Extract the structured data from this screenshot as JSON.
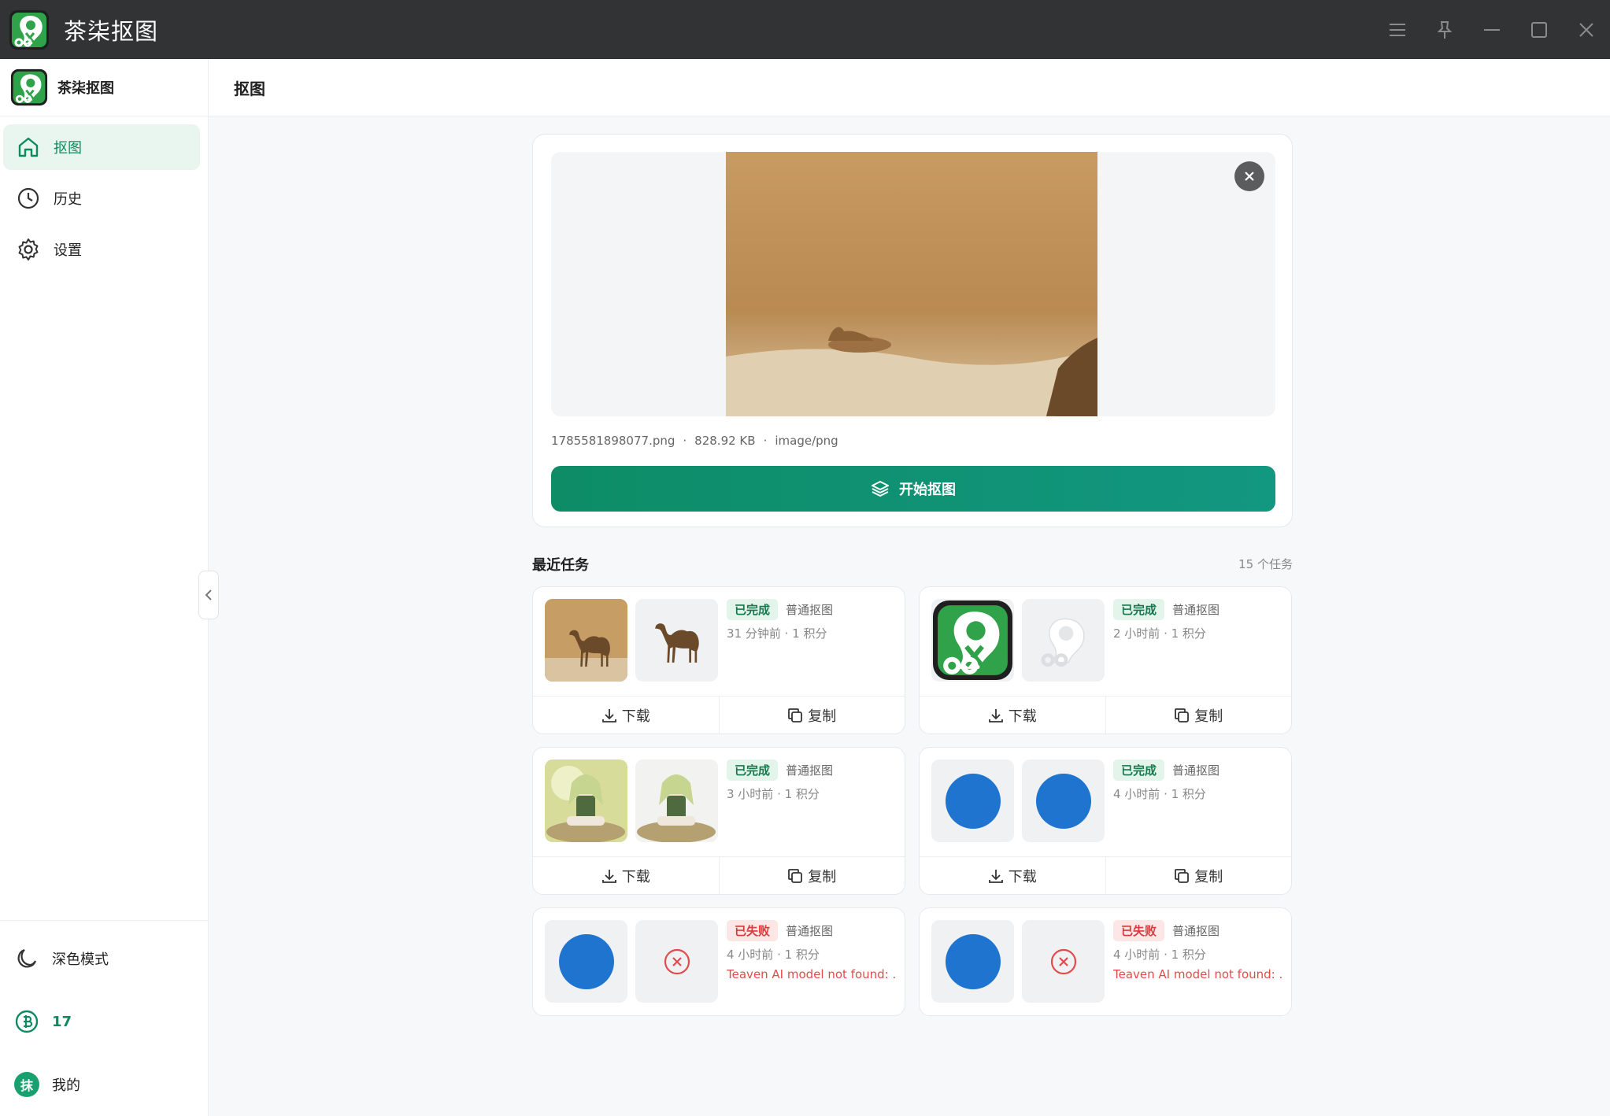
{
  "app": {
    "title": "茶柒抠图",
    "brand_name": "茶柒抠图"
  },
  "window_controls": [
    "menu-icon",
    "pin-icon",
    "minimize-icon",
    "maximize-icon",
    "close-icon"
  ],
  "sidebar": {
    "items": [
      {
        "label": "抠图",
        "icon": "home-icon",
        "active": true
      },
      {
        "label": "历史",
        "icon": "clock-icon",
        "active": false
      },
      {
        "label": "设置",
        "icon": "gear-icon",
        "active": false
      }
    ],
    "dark_mode_label": "深色模式",
    "credits": "17",
    "avatar_text": "抹",
    "profile_label": "我的"
  },
  "header": {
    "title": "抠图"
  },
  "upload": {
    "file_name": "1785581898077.png",
    "sep1": "·",
    "file_size": "828.92 KB",
    "sep2": "·",
    "file_type": "image/png",
    "start_label": "开始抠图"
  },
  "recent": {
    "title": "最近任务",
    "count": "15 个任务",
    "tasks": [
      {
        "status": "已完成",
        "kind": "普通抠图",
        "meta": "31 分钟前 · 1 积分",
        "download": "下载",
        "copy": "复制"
      },
      {
        "status": "已完成",
        "kind": "普通抠图",
        "meta": "2 小时前 · 1 积分",
        "download": "下载",
        "copy": "复制"
      },
      {
        "status": "已完成",
        "kind": "普通抠图",
        "meta": "3 小时前 · 1 积分",
        "download": "下载",
        "copy": "复制"
      },
      {
        "status": "已完成",
        "kind": "普通抠图",
        "meta": "4 小时前 · 1 积分",
        "download": "下载",
        "copy": "复制"
      },
      {
        "status": "已失败",
        "kind": "普通抠图",
        "meta": "4 小时前 · 1 积分",
        "error": "Teaven AI model not found: ..."
      },
      {
        "status": "已失败",
        "kind": "普通抠图",
        "meta": "4 小时前 · 1 积分",
        "error": "Teaven AI model not found: ..."
      }
    ]
  },
  "colors": {
    "accent": "#0e8a61",
    "success": "#18794e",
    "fail": "#d83b3b",
    "titlebar": "#323334"
  }
}
